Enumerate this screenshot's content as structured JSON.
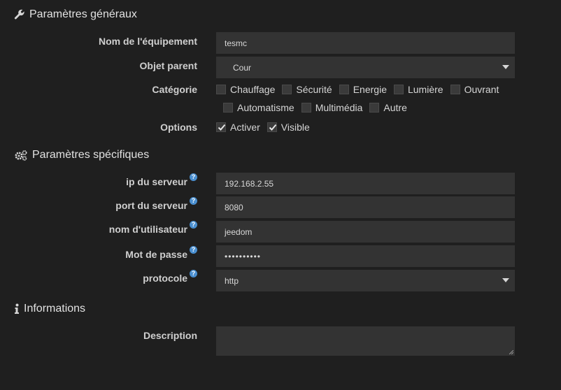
{
  "general": {
    "title": "Paramètres généraux",
    "icon": "wrench-icon",
    "name_label": "Nom de l'équipement",
    "name_value": "tesmc",
    "parent_label": "Objet parent",
    "parent_value": "Cour",
    "category_label": "Catégorie",
    "categories": [
      {
        "label": "Chauffage",
        "checked": false
      },
      {
        "label": "Sécurité",
        "checked": false
      },
      {
        "label": "Energie",
        "checked": false
      },
      {
        "label": "Lumière",
        "checked": false
      },
      {
        "label": "Ouvrant",
        "checked": false
      },
      {
        "label": "Automatisme",
        "checked": false
      },
      {
        "label": "Multimédia",
        "checked": false
      },
      {
        "label": "Autre",
        "checked": false
      }
    ],
    "options_label": "Options",
    "options": [
      {
        "label": "Activer",
        "checked": true
      },
      {
        "label": "Visible",
        "checked": true
      }
    ]
  },
  "specific": {
    "title": "Paramètres spécifiques",
    "icon": "cogs-icon",
    "ip_label": "ip du serveur",
    "ip_value": "192.168.2.55",
    "port_label": "port du serveur",
    "port_value": "8080",
    "user_label": "nom d'utilisateur",
    "user_value": "jeedom",
    "password_label": "Mot de passe",
    "password_value": "••••••••••",
    "protocol_label": "protocole",
    "protocol_value": "http",
    "help_glyph": "?"
  },
  "info": {
    "title": "Informations",
    "icon": "info-icon",
    "description_label": "Description",
    "description_value": ""
  },
  "colors": {
    "background": "#1f1f1f",
    "field": "#333333",
    "help": "#4a8fd0"
  }
}
